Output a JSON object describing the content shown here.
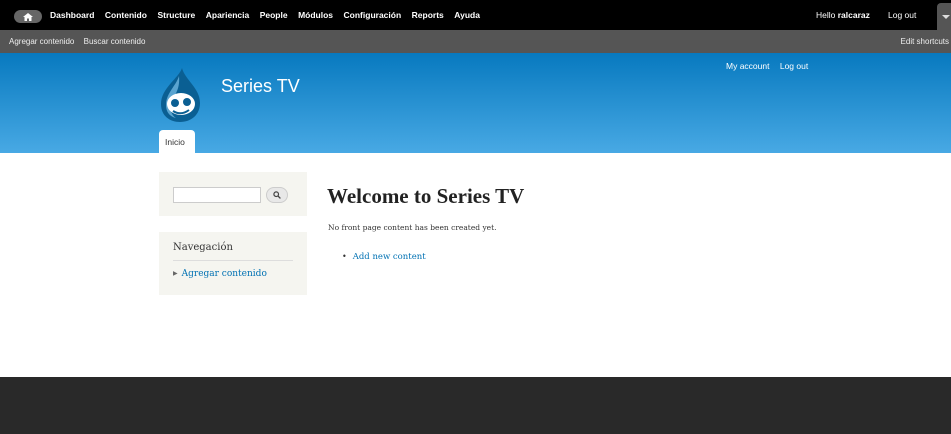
{
  "toolbar": {
    "menu": [
      "Dashboard",
      "Contenido",
      "Structure",
      "Apariencia",
      "People",
      "Módulos",
      "Configuración",
      "Reports",
      "Ayuda"
    ],
    "hello_prefix": "Hello",
    "username": "ralcaraz",
    "logout": "Log out"
  },
  "shortcuts": {
    "items": [
      "Agregar contenido",
      "Buscar contenido"
    ],
    "edit": "Edit shortcuts"
  },
  "header": {
    "site_name": "Series TV",
    "user_links": [
      "My account",
      "Log out"
    ],
    "tab": "Inicio"
  },
  "sidebar": {
    "search_placeholder": "",
    "nav_title": "Navegación",
    "nav_items": [
      "Agregar contenido"
    ]
  },
  "main": {
    "title": "Welcome to Series TV",
    "text": "No front page content has been created yet.",
    "link": "Add new content"
  },
  "colors": {
    "toolbar_bg": "#000000",
    "shortcuts_bg": "#555555",
    "header_top": "#0779bf",
    "header_bottom": "#48a9e4",
    "link": "#0071b3",
    "footer_bg": "#292929"
  },
  "icons": {
    "home": "home-icon",
    "search": "search-icon",
    "toggle": "toggle-arrow-icon",
    "logo": "drupal-drop-logo"
  }
}
